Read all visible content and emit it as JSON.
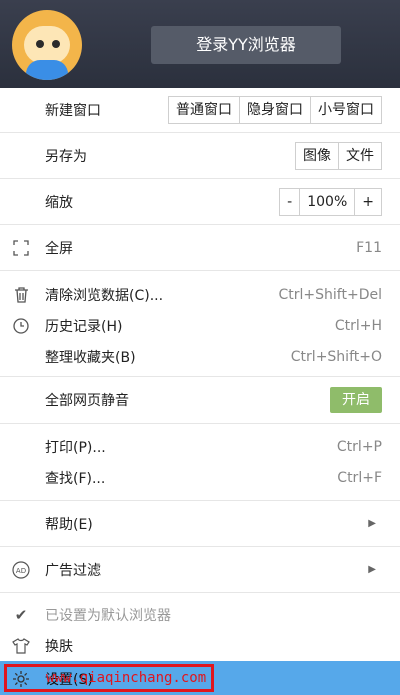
{
  "header": {
    "login_label": "登录YY浏览器"
  },
  "new_window": {
    "label": "新建窗口",
    "options": [
      "普通窗口",
      "隐身窗口",
      "小号窗口"
    ]
  },
  "save_as": {
    "label": "另存为",
    "options": [
      "图像",
      "文件"
    ]
  },
  "zoom": {
    "label": "缩放",
    "minus": "-",
    "value": "100%",
    "plus": "+"
  },
  "fullscreen": {
    "label": "全屏",
    "shortcut": "F11",
    "icon": "fullscreen-icon"
  },
  "clear_data": {
    "label": "清除浏览数据(C)...",
    "shortcut": "Ctrl+Shift+Del",
    "icon": "trash-icon"
  },
  "history": {
    "label": "历史记录(H)",
    "shortcut": "Ctrl+H",
    "icon": "clock-icon"
  },
  "bookmarks": {
    "label": "整理收藏夹(B)",
    "shortcut": "Ctrl+Shift+O"
  },
  "mute": {
    "label": "全部网页静音",
    "toggle": "开启",
    "toggle_color": "#8fbc6a"
  },
  "print": {
    "label": "打印(P)...",
    "shortcut": "Ctrl+P"
  },
  "find": {
    "label": "查找(F)...",
    "shortcut": "Ctrl+F"
  },
  "help": {
    "label": "帮助(E)"
  },
  "adblock": {
    "label": "广告过滤",
    "icon": "ad-icon"
  },
  "default_browser": {
    "label": "已设置为默认浏览器",
    "icon": "check-icon"
  },
  "skin": {
    "label": "换肤",
    "icon": "shirt-icon"
  },
  "settings": {
    "label": "设置(S)",
    "icon": "gear-icon"
  },
  "watermark": "www.qiaqinchang.com",
  "colors": {
    "header_bg": "#2b303d",
    "selected_bg": "#56a8ea",
    "highlight_border": "#e0161e"
  }
}
